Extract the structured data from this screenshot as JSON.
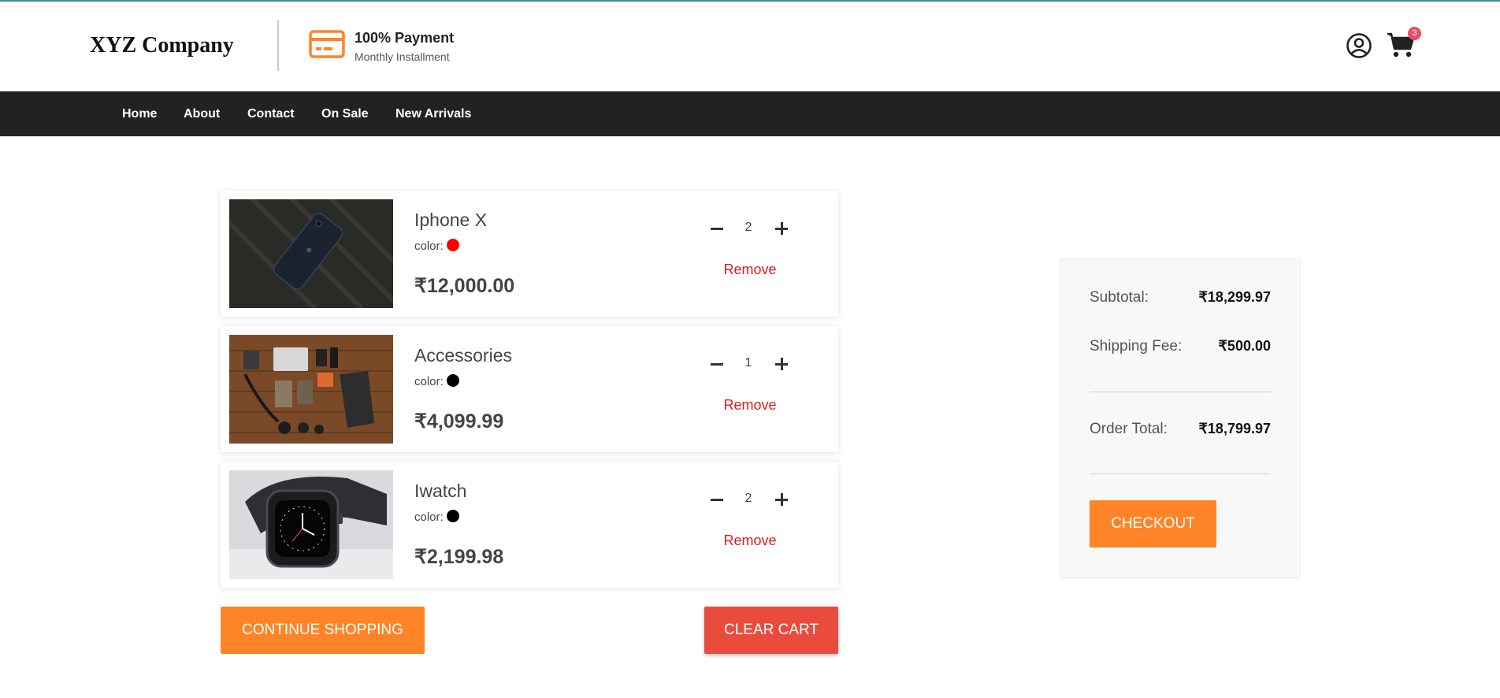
{
  "header": {
    "logo": "XYZ Company",
    "payment_title": "100% Payment",
    "payment_subtitle": "Monthly Installment",
    "payment_icon": "credit-card-icon",
    "user_icon": "user-circle-icon",
    "cart_icon": "shopping-cart-icon",
    "cart_count": "3"
  },
  "nav": {
    "items": [
      "Home",
      "About",
      "Contact",
      "On Sale",
      "New Arrivals"
    ]
  },
  "cart": {
    "items": [
      {
        "name": "Iphone X",
        "color_label": "color:",
        "color": "#ff0000",
        "price": "₹12,000.00",
        "quantity": "2",
        "remove_label": "Remove"
      },
      {
        "name": "Accessories",
        "color_label": "color:",
        "color": "#000000",
        "price": "₹4,099.99",
        "quantity": "1",
        "remove_label": "Remove"
      },
      {
        "name": "Iwatch",
        "color_label": "color:",
        "color": "#000000",
        "price": "₹2,199.98",
        "quantity": "2",
        "remove_label": "Remove"
      }
    ],
    "continue_label": "CONTINUE SHOPPING",
    "clear_label": "CLEAR CART"
  },
  "summary": {
    "subtotal_label": "Subtotal:",
    "subtotal_value": "₹18,299.97",
    "shipping_label": "Shipping Fee:",
    "shipping_value": "₹500.00",
    "total_label": "Order Total:",
    "total_value": "₹18,799.97",
    "checkout_label": "CHECKOUT"
  },
  "colors": {
    "accent": "#ff8427",
    "danger": "#e94c3d",
    "nav_bg": "#222222",
    "remove_text": "#e01b1b",
    "badge": "#e94c63"
  }
}
